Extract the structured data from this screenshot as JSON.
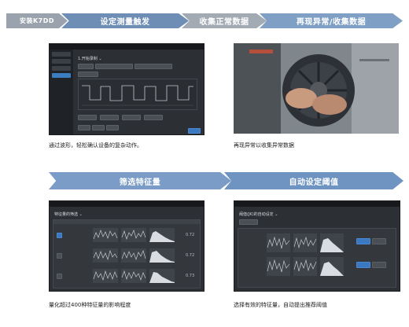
{
  "steps_top": [
    {
      "label": "安装K7DD",
      "color": "#9aa3ad"
    },
    {
      "label": "设定测量触发",
      "color": "#6e8eb5"
    },
    {
      "label": "收集正常数据",
      "color": "#a2aab3"
    },
    {
      "label": "再现异常/收集数据",
      "color": "#7fa0c4"
    }
  ],
  "steps_mid": [
    {
      "label": "筛选特征量",
      "color": "#7a9cc6"
    },
    {
      "label": "自动设定阈值",
      "color": "#6f94c2"
    }
  ],
  "captions": {
    "top_left": "通过波形，轻松确认设备的复杂动作。",
    "top_right": "再现异常以收集异常数据",
    "bottom_left": "量化超过400种特征量的影响程度",
    "bottom_right": "选择有效的特征量，自动提出推荐阈值"
  },
  "screens": {
    "trigger": {
      "title": "1.开始录制 ⌄"
    },
    "features": {
      "title": "特征量的筛选 ⌄",
      "values": [
        "0.72",
        "0.72",
        "0.73"
      ]
    },
    "threshold": {
      "title": "阈值(JK)的自动设定 ⌄"
    }
  },
  "colors": {
    "banner_dark": "#6e8eb5",
    "banner_light": "#a2aab3",
    "screen_bg": "#2c2f33",
    "accent_blue": "#3a78c1"
  }
}
